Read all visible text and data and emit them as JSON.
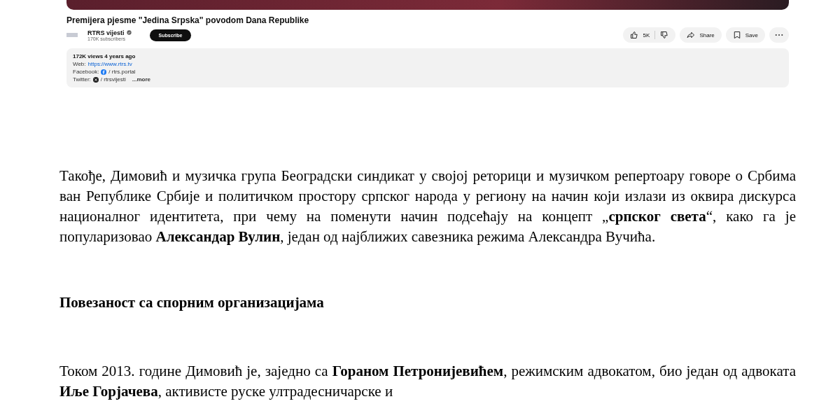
{
  "video": {
    "title": "Premijera pjesme \"Jedina Srpska\" povodom Dana Republike",
    "channel": {
      "name": "RTRS vijesti",
      "verified": true,
      "subscribers": "170K subscribers"
    },
    "subscribe": "Subscribe",
    "likes": "5K",
    "share": "Share",
    "save": "Save",
    "description": {
      "stats": "172K views  4 years ago",
      "lines": [
        {
          "kind": "link",
          "label": "Web:",
          "value": "https://www.rtrs.tv"
        },
        {
          "kind": "facebook",
          "label": "Facebook:",
          "value": "/ rtrs.portal"
        },
        {
          "kind": "x",
          "label": "Twitter:",
          "value": "/ rtrsvijesti"
        }
      ],
      "more": "...more"
    }
  },
  "article": [
    {
      "kind": "paragraph",
      "text": "Такође, Димовић и музичка група Београдски синдикат у својој реторици и музичком репертоару говоре о Србима ван Републике Србије и политичком простору српског народа у региону на начин који излази из оквира дискурса националног идентитета, при чему на поменути начин подсећају на концепт „**српског света**“, како га је популаризовао **Александар Вулин**, један од најближих савезника режима Александра Вучића."
    },
    {
      "kind": "heading",
      "text": "Повезаност са спорним организацијама"
    },
    {
      "kind": "paragraph",
      "text": "Током 2013. године Димовић је, заједно са **Гораном Петронијевићем**, режимским адвокатом, био један од адвоката **Иље Горјачева**, активисте руске ултрадесничарске и"
    }
  ]
}
